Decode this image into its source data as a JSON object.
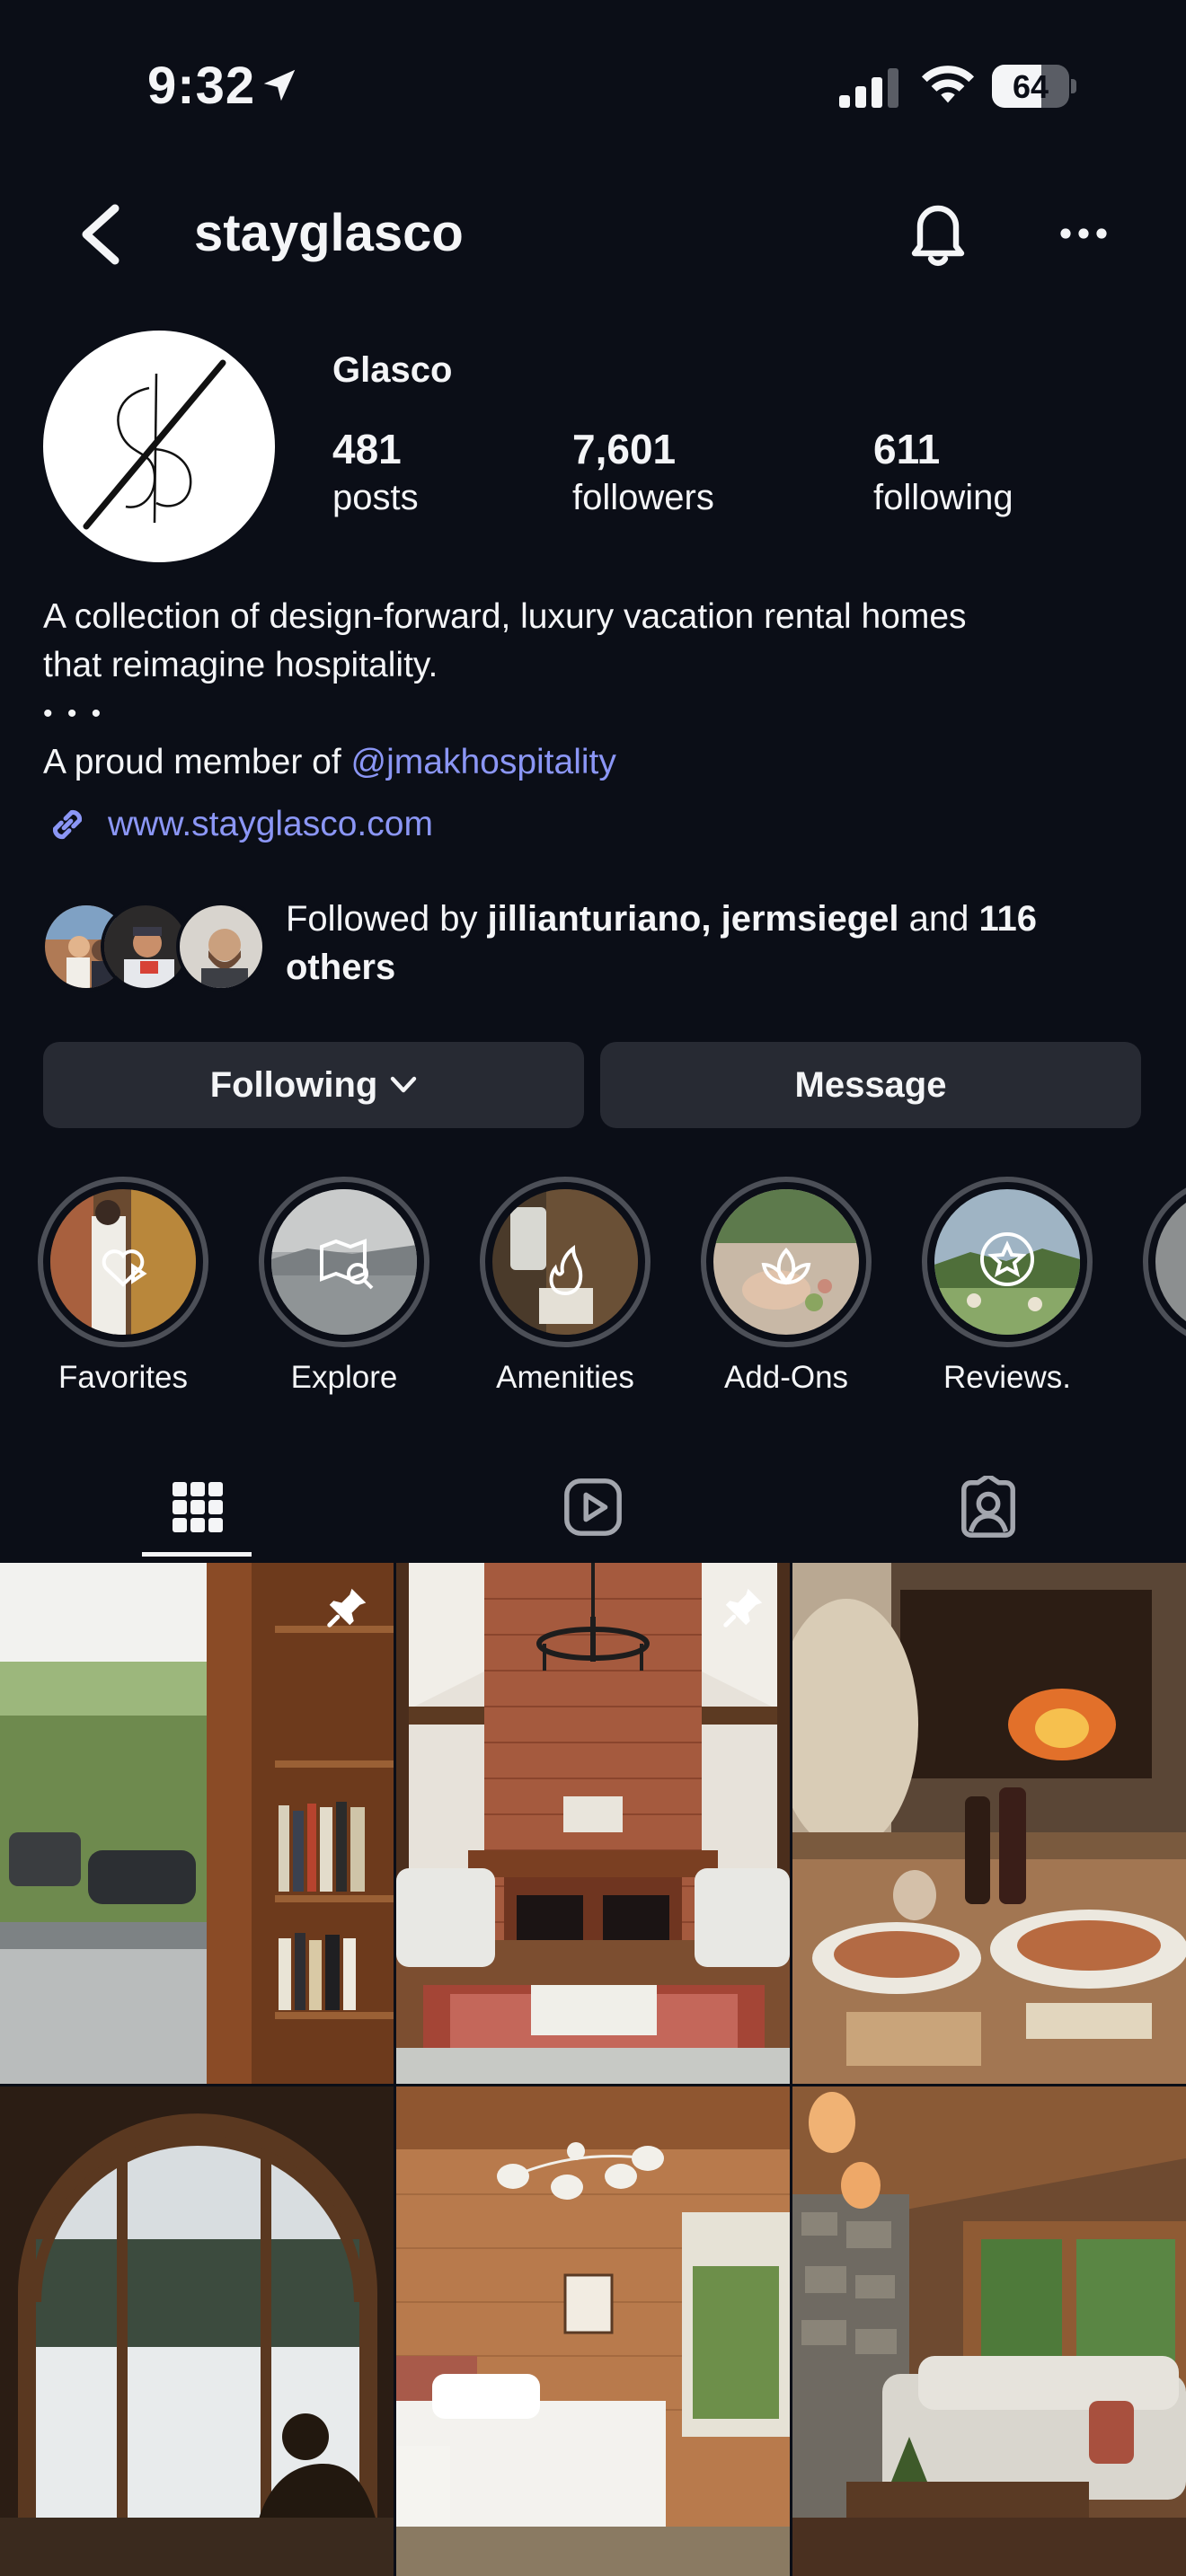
{
  "status_bar": {
    "time": "9:32",
    "battery_level": 64,
    "battery_text": "64",
    "icons": [
      "location-arrow-icon",
      "cellular-signal-icon",
      "wifi-icon",
      "battery-icon"
    ]
  },
  "nav": {
    "username": "stayglasco",
    "icons": [
      "back-chevron-icon",
      "notification-bell-icon",
      "more-dots-icon"
    ]
  },
  "profile": {
    "display_name": "Glasco",
    "stats": [
      {
        "key": "posts",
        "value": "481",
        "label": "posts"
      },
      {
        "key": "followers",
        "value": "7,601",
        "label": "followers"
      },
      {
        "key": "following",
        "value": "611",
        "label": "following"
      }
    ],
    "bio": {
      "line1": "A collection of design-forward, luxury vacation rental homes",
      "line2": "that reimagine hospitality.",
      "separator": "• • •",
      "line4_prefix": "A proud member of ",
      "mention": "@jmakhospitality"
    },
    "website": "www.stayglasco.com",
    "followed_by": {
      "prefix": "Followed by ",
      "user1": "jillianturiano",
      "comma": ", ",
      "user2": "jermsiegel",
      "and": " and ",
      "others": "116 others"
    }
  },
  "buttons": {
    "following": "Following",
    "message": "Message"
  },
  "highlights": [
    {
      "label": "Favorites",
      "icon": "heart-play-icon"
    },
    {
      "label": "Explore",
      "icon": "map-search-icon"
    },
    {
      "label": "Amenities",
      "icon": "flame-icon"
    },
    {
      "label": "Add-Ons",
      "icon": "lotus-icon"
    },
    {
      "label": "Reviews.",
      "icon": "star-circle-icon"
    }
  ],
  "tabs": [
    {
      "name": "posts",
      "icon": "grid-icon",
      "active": true
    },
    {
      "name": "reels",
      "icon": "reels-play-icon",
      "active": false
    },
    {
      "name": "tagged",
      "icon": "tagged-person-icon",
      "active": false
    }
  ],
  "posts": [
    {
      "subject": "sunroom with bookshelf",
      "pinned": true
    },
    {
      "subject": "brick fireplace living room",
      "pinned": true
    },
    {
      "subject": "fireplace with wine and charcuterie",
      "pinned": false
    },
    {
      "subject": "arched window winter view",
      "pinned": false
    },
    {
      "subject": "wood paneled bedroom with chandelier",
      "pinned": false
    },
    {
      "subject": "stone cabin living room",
      "pinned": false
    }
  ],
  "colors": {
    "background": "#0b0e17",
    "button": "#272a33",
    "link": "#8b96f5",
    "text": "#f4f5f7",
    "ring": "#4c4f57"
  }
}
